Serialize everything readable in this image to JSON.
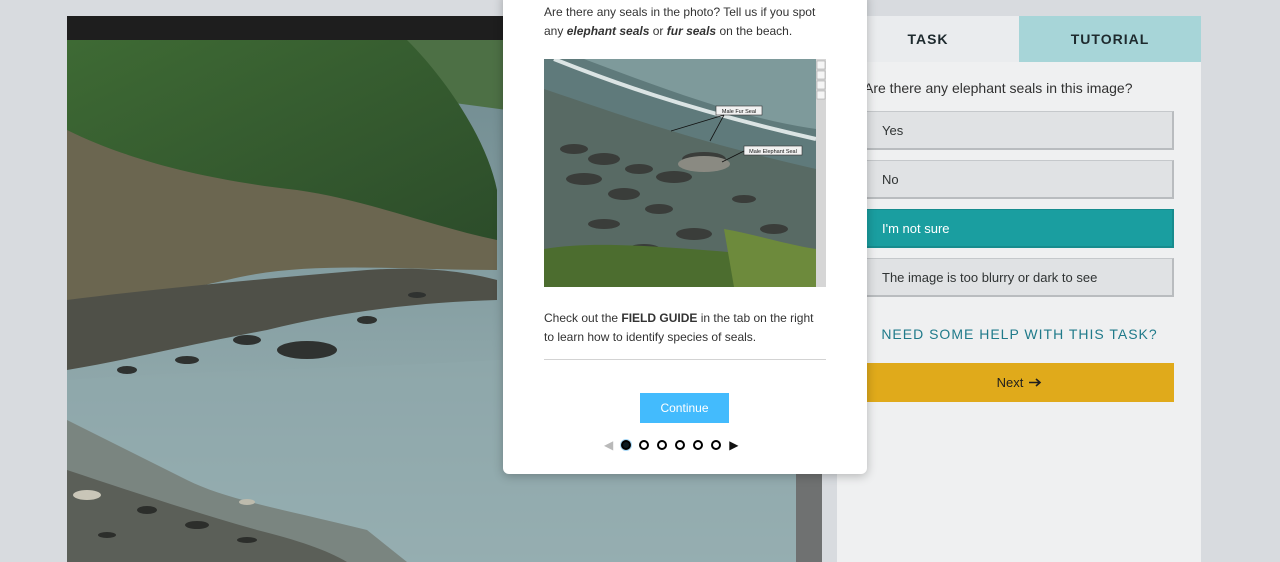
{
  "task_panel": {
    "tabs": [
      {
        "label": "TASK",
        "active": true
      },
      {
        "label": "TUTORIAL",
        "active": false
      }
    ],
    "question": "Are there any elephant seals in this image?",
    "answers": [
      {
        "label": "Yes",
        "selected": false
      },
      {
        "label": "No",
        "selected": false
      },
      {
        "label": "I'm not sure",
        "selected": true
      },
      {
        "label": "The image is too blurry or dark to see",
        "selected": false
      }
    ],
    "help_link": "NEED SOME HELP WITH THIS TASK?",
    "next_label": "Next",
    "next_icon": "arrow-right-icon"
  },
  "tutorial_modal": {
    "intro": {
      "part1": "Are there any seals in the photo? Tell us if you spot any ",
      "em1": "elephant seals",
      "part2": " or ",
      "em2": "fur seals",
      "part3": " on the beach."
    },
    "image_labels": {
      "fur_seal": "Male Fur Seal",
      "elephant_seal": "Male Elephant Seal"
    },
    "field_guide": {
      "part1": "Check out the ",
      "bold": "FIELD GUIDE",
      "part2": " in the tab on the right to learn how to identify species of seals."
    },
    "continue_label": "Continue",
    "pager": {
      "prev_arrow": "◀",
      "next_arrow": "▶",
      "total_steps": 6,
      "current_step": 1
    }
  },
  "colors": {
    "selected_answer": "#1a9ea0",
    "next_button": "#e0aa1b",
    "continue_button": "#43bbfd",
    "tutorial_tab": "#a7d5d8",
    "help_link": "#1f7a8a"
  }
}
